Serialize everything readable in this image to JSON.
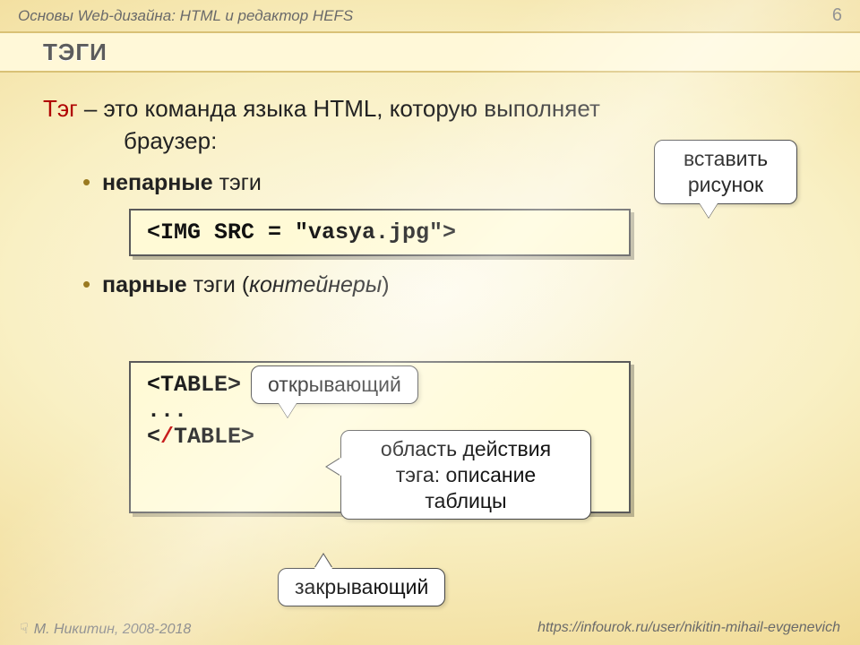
{
  "header": {
    "breadcrumb": "Основы Web-дизайна: HTML и редактор HEFS",
    "page_number": "6"
  },
  "title": "ТЭГИ",
  "definition": {
    "keyword": "Тэг",
    "rest_line1": " – это команда языка HTML, которую выполняет",
    "line2": "браузер:"
  },
  "bullets": {
    "unpaired": {
      "bold": "непарные",
      "rest": " тэги"
    },
    "paired": {
      "bold": "парные",
      "rest": " тэги (",
      "ital": "контейнеры",
      "rest2": ")"
    }
  },
  "code": {
    "img": "<IMG SRC = \"vasya.jpg\">",
    "table_open": "<TABLE>",
    "table_dots": "...",
    "table_close_pre": "<",
    "table_close_slash": "/",
    "table_close_post": "TABLE>"
  },
  "callouts": {
    "insert_image": "вставить\nрисунок",
    "opening": "открывающий",
    "scope": "область действия\nтэга: описание\nтаблицы",
    "closing": "закрывающий"
  },
  "footer": {
    "author": "М. Никитин, 2008-2018",
    "url": "https://infourok.ru/user/nikitin-mihail-evgenevich"
  }
}
